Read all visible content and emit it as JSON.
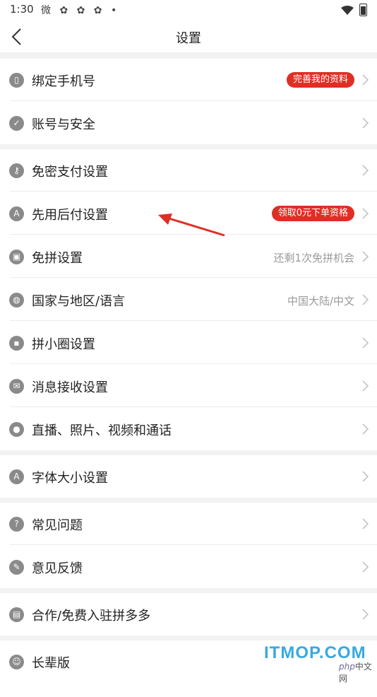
{
  "status_bar": {
    "time": "1:30",
    "notification_icons": "微 ✿ ✿ ✿ •"
  },
  "header": {
    "title": "设置"
  },
  "groups": [
    [
      {
        "icon": "phone-icon",
        "glyph": "▯",
        "label": "绑定手机号",
        "badge": "完善我的资料"
      },
      {
        "icon": "shield-icon",
        "glyph": "✓",
        "label": "账号与安全"
      }
    ],
    [
      {
        "icon": "key-icon",
        "glyph": "⚷",
        "label": "免密支付设置"
      },
      {
        "icon": "pay-later-icon",
        "glyph": "A",
        "label": "先用后付设置",
        "badge": "领取0元下单资格"
      },
      {
        "icon": "group-buy-icon",
        "glyph": "▣",
        "label": "免拼设置",
        "value": "还剩1次免拼机会"
      },
      {
        "icon": "globe-icon",
        "glyph": "◍",
        "label": "国家与地区/语言",
        "value": "中国大陆/中文"
      },
      {
        "icon": "lock-icon",
        "glyph": "▪",
        "label": "拼小圈设置"
      },
      {
        "icon": "mail-icon",
        "glyph": "✉",
        "label": "消息接收设置"
      },
      {
        "icon": "camera-icon",
        "glyph": "●",
        "label": "直播、照片、视频和通话"
      }
    ],
    [
      {
        "icon": "font-size-icon",
        "glyph": "A",
        "label": "字体大小设置"
      }
    ],
    [
      {
        "icon": "help-icon",
        "glyph": "?",
        "label": "常见问题"
      },
      {
        "icon": "feedback-icon",
        "glyph": "✎",
        "label": "意见反馈"
      }
    ],
    [
      {
        "icon": "store-icon",
        "glyph": "▤",
        "label": "合作/免费入驻拼多多"
      }
    ],
    [
      {
        "icon": "elder-icon",
        "glyph": "☺",
        "label": "长辈版"
      }
    ]
  ],
  "watermark": {
    "main": "ITMOP.COM",
    "php": "php",
    "sub": "中文网"
  },
  "colors": {
    "badge": "#e02e24",
    "icon": "#8a8a8a",
    "arrow": "#e02e24",
    "watermark": "#38a9e0"
  }
}
